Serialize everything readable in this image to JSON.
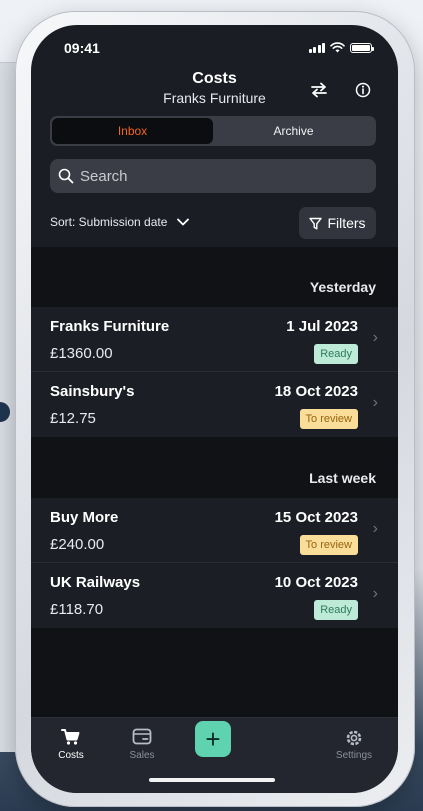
{
  "status_bar": {
    "time": "09:41"
  },
  "header": {
    "title": "Costs",
    "subtitle": "Franks Furniture"
  },
  "segments": {
    "inbox": "Inbox",
    "archive": "Archive"
  },
  "search": {
    "placeholder": "Search"
  },
  "sort": {
    "label": "Sort: Submission date"
  },
  "filters": {
    "label": "Filters"
  },
  "groups": [
    {
      "label": "Yesterday",
      "items": [
        {
          "merchant": "Franks Furniture",
          "amount": "£1360.00",
          "date": "1 Jul 2023",
          "status": "Ready"
        },
        {
          "merchant": "Sainsbury's",
          "amount": "£12.75",
          "date": "18 Oct 2023",
          "status": "To review"
        }
      ]
    },
    {
      "label": "Last week",
      "items": [
        {
          "merchant": "Buy More",
          "amount": "£240.00",
          "date": "15 Oct 2023",
          "status": "To review"
        },
        {
          "merchant": "UK Railways",
          "amount": "£118.70",
          "date": "10 Oct 2023",
          "status": "Ready"
        }
      ]
    }
  ],
  "tabs": {
    "costs": "Costs",
    "sales": "Sales",
    "settings": "Settings"
  },
  "colors": {
    "accent": "#f26522",
    "ready_bg": "#bdebd8",
    "review_bg": "#fbdd9a",
    "add_button": "#5fd3b0"
  },
  "icons": {
    "swap": "swap-arrows-icon",
    "info": "info-icon",
    "search": "search-icon",
    "chevron": "chevron-down-icon",
    "filter": "filter-icon",
    "cart": "cart-icon",
    "wallet": "wallet-icon",
    "plus": "plus-icon",
    "gear": "gear-icon"
  }
}
